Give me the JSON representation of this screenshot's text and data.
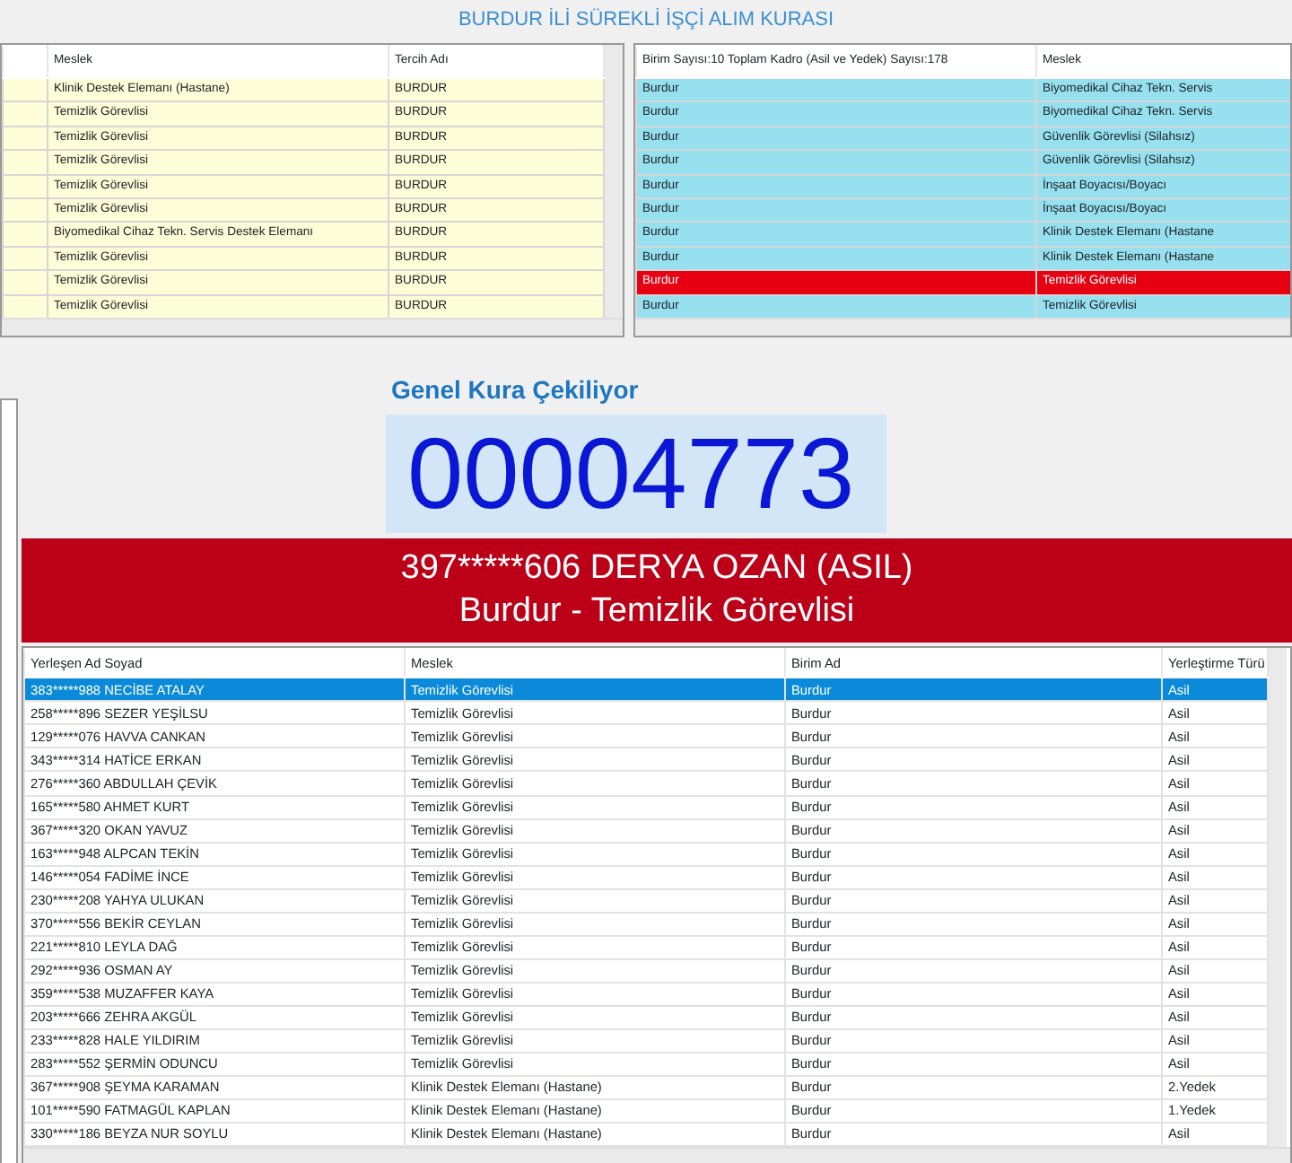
{
  "title": "BURDUR İLİ SÜREKLİ İŞÇİ ALIM KURASI",
  "left_table": {
    "columns": [
      "Meslek",
      "Tercih Adı"
    ],
    "rows": [
      {
        "cells": [
          "Klinik Destek Elemanı (Hastane)",
          "BURDUR"
        ]
      },
      {
        "cells": [
          "Temizlik Görevlisi",
          "BURDUR"
        ]
      },
      {
        "cells": [
          "Temizlik Görevlisi",
          "BURDUR"
        ]
      },
      {
        "cells": [
          "Temizlik Görevlisi",
          "BURDUR"
        ]
      },
      {
        "cells": [
          "Temizlik Görevlisi",
          "BURDUR"
        ]
      },
      {
        "cells": [
          "Temizlik Görevlisi",
          "BURDUR"
        ]
      },
      {
        "cells": [
          "Biyomedikal Cihaz Tekn. Servis Destek Elemanı",
          "BURDUR"
        ]
      },
      {
        "cells": [
          "Temizlik Görevlisi",
          "BURDUR"
        ]
      },
      {
        "cells": [
          "Temizlik Görevlisi",
          "BURDUR"
        ]
      },
      {
        "cells": [
          "Temizlik Görevlisi",
          "BURDUR"
        ]
      }
    ]
  },
  "right_table": {
    "columns": [
      "Birim Sayısı:10 Toplam Kadro (Asil ve Yedek) Sayısı:178",
      "Meslek"
    ],
    "rows": [
      {
        "cells": [
          "Burdur",
          "Biyomedikal Cihaz Tekn. Servis"
        ],
        "highlighted": false
      },
      {
        "cells": [
          "Burdur",
          "Biyomedikal Cihaz Tekn. Servis"
        ],
        "highlighted": false
      },
      {
        "cells": [
          "Burdur",
          "Güvenlik Görevlisi (Silahsız)"
        ],
        "highlighted": false
      },
      {
        "cells": [
          "Burdur",
          "Güvenlik Görevlisi (Silahsız)"
        ],
        "highlighted": false
      },
      {
        "cells": [
          "Burdur",
          "İnşaat Boyacısı/Boyacı"
        ],
        "highlighted": false
      },
      {
        "cells": [
          "Burdur",
          "İnşaat Boyacısı/Boyacı"
        ],
        "highlighted": false
      },
      {
        "cells": [
          "Burdur",
          "Klinik Destek Elemanı (Hastane"
        ],
        "highlighted": false
      },
      {
        "cells": [
          "Burdur",
          "Klinik Destek Elemanı (Hastane"
        ],
        "highlighted": false
      },
      {
        "cells": [
          "Burdur",
          "Temizlik Görevlisi"
        ],
        "highlighted": true
      },
      {
        "cells": [
          "Burdur",
          "Temizlik Görevlisi"
        ],
        "highlighted": false
      }
    ]
  },
  "draw": {
    "heading": "Genel Kura Çekiliyor",
    "number": "00004773",
    "winner_line": "397*****606 DERYA OZAN (ASIL)",
    "winner_detail": "Burdur - Temizlik Görevlisi"
  },
  "results": {
    "columns": [
      "Yerleşen Ad Soyad",
      "Meslek",
      "Birim Ad",
      "Yerleştirme Türü"
    ],
    "rows": [
      {
        "cells": [
          "383*****988 NECİBE ATALAY",
          "Temizlik Görevlisi",
          "Burdur",
          "Asil"
        ],
        "selected": true
      },
      {
        "cells": [
          "258*****896 SEZER YEŞİLSU",
          "Temizlik Görevlisi",
          "Burdur",
          "Asil"
        ],
        "selected": false
      },
      {
        "cells": [
          "129*****076 HAVVA CANKAN",
          "Temizlik Görevlisi",
          "Burdur",
          "Asil"
        ],
        "selected": false
      },
      {
        "cells": [
          "343*****314 HATİCE ERKAN",
          "Temizlik Görevlisi",
          "Burdur",
          "Asil"
        ],
        "selected": false
      },
      {
        "cells": [
          "276*****360 ABDULLAH ÇEVİK",
          "Temizlik Görevlisi",
          "Burdur",
          "Asil"
        ],
        "selected": false
      },
      {
        "cells": [
          "165*****580 AHMET KURT",
          "Temizlik Görevlisi",
          "Burdur",
          "Asil"
        ],
        "selected": false
      },
      {
        "cells": [
          "367*****320 OKAN YAVUZ",
          "Temizlik Görevlisi",
          "Burdur",
          "Asil"
        ],
        "selected": false
      },
      {
        "cells": [
          "163*****948 ALPCAN TEKİN",
          "Temizlik Görevlisi",
          "Burdur",
          "Asil"
        ],
        "selected": false
      },
      {
        "cells": [
          "146*****054 FADİME İNCE",
          "Temizlik Görevlisi",
          "Burdur",
          "Asil"
        ],
        "selected": false
      },
      {
        "cells": [
          "230*****208 YAHYA ULUKAN",
          "Temizlik Görevlisi",
          "Burdur",
          "Asil"
        ],
        "selected": false
      },
      {
        "cells": [
          "370*****556 BEKİR CEYLAN",
          "Temizlik Görevlisi",
          "Burdur",
          "Asil"
        ],
        "selected": false
      },
      {
        "cells": [
          "221*****810 LEYLA DAĞ",
          "Temizlik Görevlisi",
          "Burdur",
          "Asil"
        ],
        "selected": false
      },
      {
        "cells": [
          "292*****936 OSMAN AY",
          "Temizlik Görevlisi",
          "Burdur",
          "Asil"
        ],
        "selected": false
      },
      {
        "cells": [
          "359*****538 MUZAFFER KAYA",
          "Temizlik Görevlisi",
          "Burdur",
          "Asil"
        ],
        "selected": false
      },
      {
        "cells": [
          "203*****666 ZEHRA AKGÜL",
          "Temizlik Görevlisi",
          "Burdur",
          "Asil"
        ],
        "selected": false
      },
      {
        "cells": [
          "233*****828 HALE YILDIRIM",
          "Temizlik Görevlisi",
          "Burdur",
          "Asil"
        ],
        "selected": false
      },
      {
        "cells": [
          "283*****552 ŞERMİN ODUNCU",
          "Temizlik Görevlisi",
          "Burdur",
          "Asil"
        ],
        "selected": false
      },
      {
        "cells": [
          "367*****908 ŞEYMA KARAMAN",
          "Klinik Destek Elemanı (Hastane)",
          "Burdur",
          "2.Yedek"
        ],
        "selected": false
      },
      {
        "cells": [
          "101*****590 FATMAGÜL KAPLAN",
          "Klinik Destek Elemanı (Hastane)",
          "Burdur",
          "1.Yedek"
        ],
        "selected": false
      },
      {
        "cells": [
          "330*****186 BEYZA NUR SOYLU",
          "Klinik Destek Elemanı (Hastane)",
          "Burdur",
          "Asil"
        ],
        "selected": false
      }
    ]
  }
}
